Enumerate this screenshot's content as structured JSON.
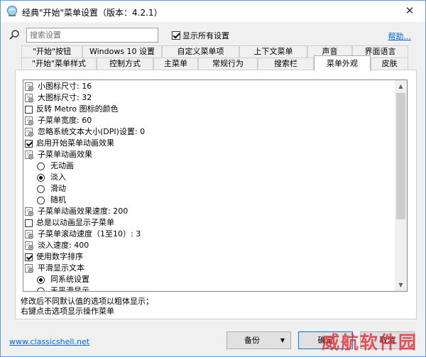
{
  "window": {
    "title": "经典\"开始\"菜单设置（版本：4.2.1）",
    "close_glyph": "✕",
    "accent": "#5d9ce0"
  },
  "search": {
    "placeholder": "搜索设置",
    "value": "",
    "show_all_label": "显示所有设置",
    "show_all_checked": true,
    "help_link": "帮助..."
  },
  "tabs": {
    "row1": [
      "\"开始\"按钮",
      "Windows 10 设置",
      "自定义菜单项",
      "上下文菜单",
      "声音",
      "界面语言"
    ],
    "row2": [
      "\"开始\"菜单样式",
      "控制方式",
      "主菜单",
      "常规行为",
      "搜索栏",
      "菜单外观",
      "皮肤"
    ],
    "active": "菜单外观"
  },
  "settings": [
    {
      "kind": "icon",
      "icon": "gear-icon",
      "label": "小图标尺寸: 16"
    },
    {
      "kind": "icon",
      "icon": "gear-icon",
      "label": "大图标尺寸: 32"
    },
    {
      "kind": "checkbox",
      "checked": false,
      "label": "反转 Metro 图标的颜色"
    },
    {
      "kind": "icon",
      "icon": "gear-icon",
      "label": "子菜单宽度: 60"
    },
    {
      "kind": "icon",
      "icon": "gear-icon",
      "label": "忽略系统文本大小(DPI)设置: 0"
    },
    {
      "kind": "checkbox",
      "checked": true,
      "label": "启用开始菜单动画效果"
    },
    {
      "kind": "icon",
      "icon": "gear-icon",
      "label": "子菜单动画效果"
    },
    {
      "kind": "radio",
      "checked": false,
      "label": "无动画"
    },
    {
      "kind": "radio",
      "checked": true,
      "label": "淡入"
    },
    {
      "kind": "radio",
      "checked": false,
      "label": "滑动"
    },
    {
      "kind": "radio",
      "checked": false,
      "label": "随机"
    },
    {
      "kind": "icon",
      "icon": "gear-icon",
      "label": "子菜单动画效果速度: 200"
    },
    {
      "kind": "checkbox",
      "checked": false,
      "label": "总是以动画显示子菜单"
    },
    {
      "kind": "icon",
      "icon": "gear-icon",
      "label": "子菜单滚动速度（1至10）: 3"
    },
    {
      "kind": "icon",
      "icon": "gear-icon",
      "label": "淡入速度: 400"
    },
    {
      "kind": "checkbox",
      "checked": true,
      "label": "使用数字排序"
    },
    {
      "kind": "icon",
      "icon": "gear-icon",
      "label": "平滑显示文本"
    },
    {
      "kind": "radio",
      "checked": true,
      "label": "同系统设置"
    },
    {
      "kind": "radio",
      "checked": false,
      "label": "无平滑显示"
    }
  ],
  "description": {
    "line1": "修改后不同默认值的选项以粗体显示；",
    "line2": "右键点击选项显示操作菜单"
  },
  "footer": {
    "website": "www.classicshell.net",
    "backup_label": "备份",
    "ok_label": "确定",
    "cancel_label": "取消",
    "watermark": "威航软件园"
  }
}
